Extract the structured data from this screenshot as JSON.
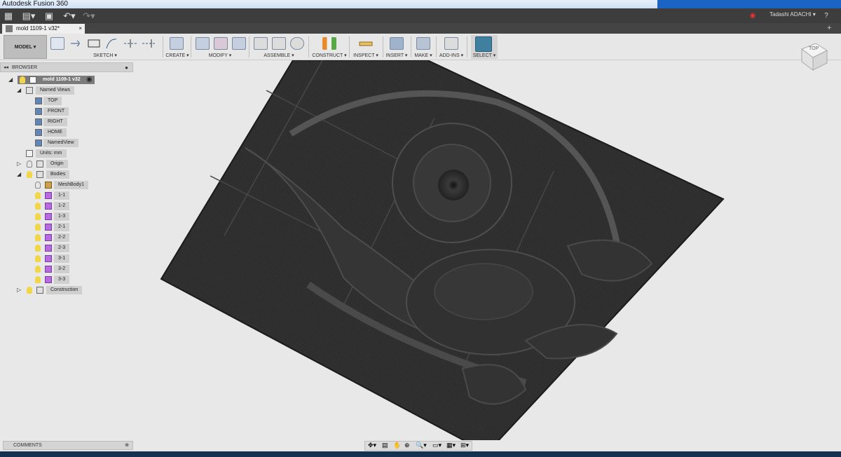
{
  "window": {
    "title": "Autodesk Fusion 360"
  },
  "appbar": {
    "user": "Tadashi ADACHI ▾",
    "help": "?"
  },
  "doc_tab": {
    "name": "mold 1109-1 v32*",
    "close": "×"
  },
  "toolbar": {
    "model": "MODEL ▾",
    "groups": [
      "SKETCH ▾",
      "CREATE ▾",
      "MODIFY ▾",
      "ASSEMBLE ▾",
      "CONSTRUCT ▾",
      "INSPECT ▾",
      "INSERT ▾",
      "MAKE ▾",
      "ADD-INS ▾",
      "SELECT ▾"
    ]
  },
  "browser": {
    "title": "BROWSER",
    "root": "mold 1109-1 v32",
    "named_views": "Named Views",
    "views": [
      "TOP",
      "FRONT",
      "RIGHT",
      "HOME",
      "NamedView"
    ],
    "units": "Units: mm",
    "origin": "Origin",
    "bodies": "Bodies",
    "meshbody": "MeshBody1",
    "body_items": [
      "1-1",
      "1-2",
      "1-3",
      "2-1",
      "2-2",
      "2-3",
      "3-1",
      "3-2",
      "3-3"
    ],
    "construction": "Construction"
  },
  "viewcube": {
    "label": "TOP"
  },
  "comments": {
    "label": "COMMENTS"
  },
  "colors": {
    "accent": "#1b64c4",
    "mesh": "#2a2a2a",
    "body_icon": "#b76be0",
    "bulb": "#f2d64a"
  }
}
